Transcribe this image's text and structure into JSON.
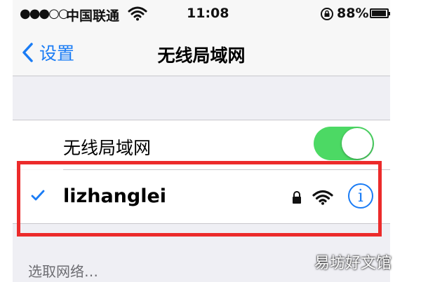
{
  "status_bar": {
    "signal": "●●●○○",
    "carrier": "中国联通",
    "time": "11:08",
    "battery_percent": "88%"
  },
  "nav": {
    "back_label": "设置",
    "title": "无线局域网"
  },
  "wifi_toggle": {
    "label": "无线局域网",
    "on": true
  },
  "network": {
    "name": "lizhanglei",
    "connected": true,
    "secured": true,
    "info_symbol": "i"
  },
  "section": {
    "header": "选取网络…"
  },
  "watermark": "易坊好文馆",
  "colors": {
    "accent": "#1a7cf5",
    "toggle_on": "#4cd964",
    "highlight": "#ec2b2b",
    "background": "#efeff4"
  }
}
